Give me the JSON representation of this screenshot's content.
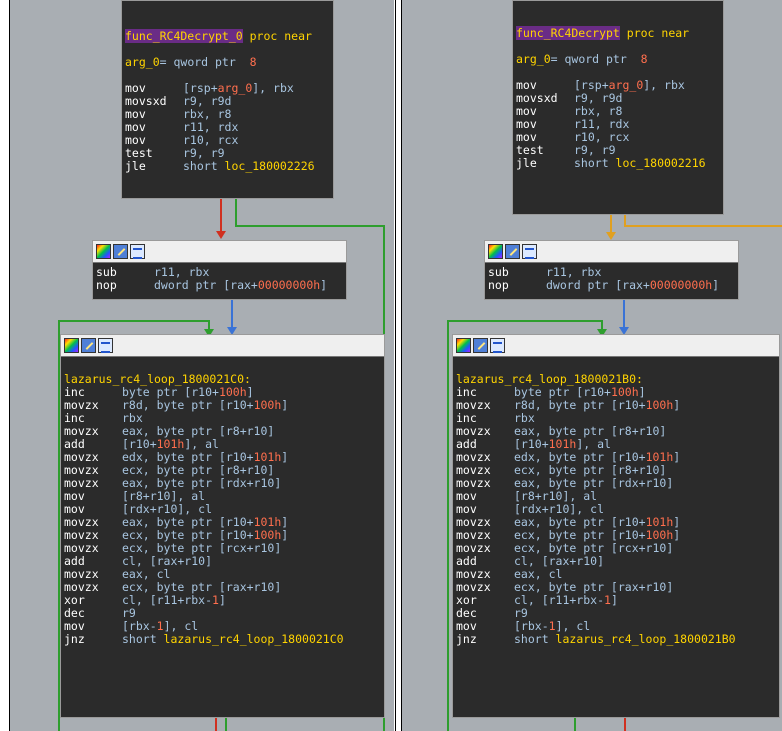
{
  "left": {
    "proc": {
      "func_name": "func_RC4Decrypt_0",
      "proc_kw": " proc near",
      "arg_name": "arg_0",
      "arg_decl": "= qword ptr  ",
      "arg_off": "8",
      "lines": [
        {
          "m": "mov",
          "p": [
            [
              "op",
              "[rsp+"
            ],
            [
              "arg",
              "arg_0"
            ],
            [
              "op",
              "], rbx"
            ]
          ]
        },
        {
          "m": "movsxd",
          "p": [
            [
              "op",
              "r9, r9d"
            ]
          ]
        },
        {
          "m": "mov",
          "p": [
            [
              "op",
              "rbx, r8"
            ]
          ]
        },
        {
          "m": "mov",
          "p": [
            [
              "op",
              "r11, rdx"
            ]
          ]
        },
        {
          "m": "mov",
          "p": [
            [
              "op",
              "r10, rcx"
            ]
          ]
        },
        {
          "m": "test",
          "p": [
            [
              "op",
              "r9, r9"
            ]
          ]
        },
        {
          "m": "jle",
          "p": [
            [
              "op",
              "short "
            ],
            [
              "lbl",
              "loc_180002226"
            ]
          ]
        }
      ]
    },
    "mid": {
      "lines": [
        {
          "m": "sub",
          "p": [
            [
              "op",
              "r11, rbx"
            ]
          ]
        },
        {
          "m": "nop",
          "p": [
            [
              "op",
              "dword ptr [rax+"
            ],
            [
              "num",
              "00000000h"
            ],
            [
              "op",
              "]"
            ]
          ]
        }
      ]
    },
    "loop": {
      "label": "lazarus_rc4_loop_1800021C0:",
      "lines": [
        {
          "m": "inc",
          "p": [
            [
              "op",
              "byte ptr [r10+"
            ],
            [
              "num",
              "100h"
            ],
            [
              "op",
              "]"
            ]
          ]
        },
        {
          "m": "movzx",
          "p": [
            [
              "op",
              "r8d, byte ptr [r10+"
            ],
            [
              "num",
              "100h"
            ],
            [
              "op",
              "]"
            ]
          ]
        },
        {
          "m": "inc",
          "p": [
            [
              "op",
              "rbx"
            ]
          ]
        },
        {
          "m": "movzx",
          "p": [
            [
              "op",
              "eax, byte ptr [r8+r10]"
            ]
          ]
        },
        {
          "m": "add",
          "p": [
            [
              "op",
              "[r10+"
            ],
            [
              "num",
              "101h"
            ],
            [
              "op",
              "], al"
            ]
          ]
        },
        {
          "m": "movzx",
          "p": [
            [
              "op",
              "edx, byte ptr [r10+"
            ],
            [
              "num",
              "101h"
            ],
            [
              "op",
              "]"
            ]
          ]
        },
        {
          "m": "movzx",
          "p": [
            [
              "op",
              "ecx, byte ptr [r8+r10]"
            ]
          ]
        },
        {
          "m": "movzx",
          "p": [
            [
              "op",
              "eax, byte ptr [rdx+r10]"
            ]
          ]
        },
        {
          "m": "mov",
          "p": [
            [
              "op",
              "[r8+r10], al"
            ]
          ]
        },
        {
          "m": "mov",
          "p": [
            [
              "op",
              "[rdx+r10], cl"
            ]
          ]
        },
        {
          "m": "movzx",
          "p": [
            [
              "op",
              "eax, byte ptr [r10+"
            ],
            [
              "num",
              "101h"
            ],
            [
              "op",
              "]"
            ]
          ]
        },
        {
          "m": "movzx",
          "p": [
            [
              "op",
              "ecx, byte ptr [r10+"
            ],
            [
              "num",
              "100h"
            ],
            [
              "op",
              "]"
            ]
          ]
        },
        {
          "m": "movzx",
          "p": [
            [
              "op",
              "ecx, byte ptr [rcx+r10]"
            ]
          ]
        },
        {
          "m": "add",
          "p": [
            [
              "op",
              "cl, [rax+r10]"
            ]
          ]
        },
        {
          "m": "movzx",
          "p": [
            [
              "op",
              "eax, cl"
            ]
          ]
        },
        {
          "m": "movzx",
          "p": [
            [
              "op",
              "ecx, byte ptr [rax+r10]"
            ]
          ]
        },
        {
          "m": "xor",
          "p": [
            [
              "op",
              "cl, [r11+rbx-"
            ],
            [
              "num",
              "1"
            ],
            [
              "op",
              "]"
            ]
          ]
        },
        {
          "m": "dec",
          "p": [
            [
              "op",
              "r9"
            ]
          ]
        },
        {
          "m": "mov",
          "p": [
            [
              "op",
              "[rbx-"
            ],
            [
              "num",
              "1"
            ],
            [
              "op",
              "], cl"
            ]
          ]
        },
        {
          "m": "jnz",
          "p": [
            [
              "op",
              "short "
            ],
            [
              "lbl",
              "lazarus_rc4_loop_1800021C0"
            ]
          ]
        }
      ]
    }
  },
  "right": {
    "proc": {
      "func_name": "func_RC4Decrypt",
      "proc_kw": " proc near",
      "arg_name": "arg_0",
      "arg_decl": "= qword ptr  ",
      "arg_off": "8",
      "lines": [
        {
          "m": "mov",
          "p": [
            [
              "op",
              "[rsp+"
            ],
            [
              "arg",
              "arg_0"
            ],
            [
              "op",
              "], rbx"
            ]
          ]
        },
        {
          "m": "movsxd",
          "p": [
            [
              "op",
              "r9, r9d"
            ]
          ]
        },
        {
          "m": "mov",
          "p": [
            [
              "op",
              "rbx, r8"
            ]
          ]
        },
        {
          "m": "mov",
          "p": [
            [
              "op",
              "r11, rdx"
            ]
          ]
        },
        {
          "m": "mov",
          "p": [
            [
              "op",
              "r10, rcx"
            ]
          ]
        },
        {
          "m": "test",
          "p": [
            [
              "op",
              "r9, r9"
            ]
          ]
        },
        {
          "m": "jle",
          "p": [
            [
              "op",
              "short "
            ],
            [
              "lbl",
              "loc_180002216"
            ]
          ]
        }
      ]
    },
    "mid": {
      "lines": [
        {
          "m": "sub",
          "p": [
            [
              "op",
              "r11, rbx"
            ]
          ]
        },
        {
          "m": "nop",
          "p": [
            [
              "op",
              "dword ptr [rax+"
            ],
            [
              "num",
              "00000000h"
            ],
            [
              "op",
              "]"
            ]
          ]
        }
      ]
    },
    "loop": {
      "label": "lazarus_rc4_loop_1800021B0:",
      "lines": [
        {
          "m": "inc",
          "p": [
            [
              "op",
              "byte ptr [r10+"
            ],
            [
              "num",
              "100h"
            ],
            [
              "op",
              "]"
            ]
          ]
        },
        {
          "m": "movzx",
          "p": [
            [
              "op",
              "r8d, byte ptr [r10+"
            ],
            [
              "num",
              "100h"
            ],
            [
              "op",
              "]"
            ]
          ]
        },
        {
          "m": "inc",
          "p": [
            [
              "op",
              "rbx"
            ]
          ]
        },
        {
          "m": "movzx",
          "p": [
            [
              "op",
              "eax, byte ptr [r8+r10]"
            ]
          ]
        },
        {
          "m": "add",
          "p": [
            [
              "op",
              "[r10+"
            ],
            [
              "num",
              "101h"
            ],
            [
              "op",
              "], al"
            ]
          ]
        },
        {
          "m": "movzx",
          "p": [
            [
              "op",
              "edx, byte ptr [r10+"
            ],
            [
              "num",
              "101h"
            ],
            [
              "op",
              "]"
            ]
          ]
        },
        {
          "m": "movzx",
          "p": [
            [
              "op",
              "ecx, byte ptr [r8+r10]"
            ]
          ]
        },
        {
          "m": "movzx",
          "p": [
            [
              "op",
              "eax, byte ptr [rdx+r10]"
            ]
          ]
        },
        {
          "m": "mov",
          "p": [
            [
              "op",
              "[r8+r10], al"
            ]
          ]
        },
        {
          "m": "mov",
          "p": [
            [
              "op",
              "[rdx+r10], cl"
            ]
          ]
        },
        {
          "m": "movzx",
          "p": [
            [
              "op",
              "eax, byte ptr [r10+"
            ],
            [
              "num",
              "101h"
            ],
            [
              "op",
              "]"
            ]
          ]
        },
        {
          "m": "movzx",
          "p": [
            [
              "op",
              "ecx, byte ptr [r10+"
            ],
            [
              "num",
              "100h"
            ],
            [
              "op",
              "]"
            ]
          ]
        },
        {
          "m": "movzx",
          "p": [
            [
              "op",
              "ecx, byte ptr [rcx+r10]"
            ]
          ]
        },
        {
          "m": "add",
          "p": [
            [
              "op",
              "cl, [rax+r10]"
            ]
          ]
        },
        {
          "m": "movzx",
          "p": [
            [
              "op",
              "eax, cl"
            ]
          ]
        },
        {
          "m": "movzx",
          "p": [
            [
              "op",
              "ecx, byte ptr [rax+r10]"
            ]
          ]
        },
        {
          "m": "xor",
          "p": [
            [
              "op",
              "cl, [r11+rbx-"
            ],
            [
              "num",
              "1"
            ],
            [
              "op",
              "]"
            ]
          ]
        },
        {
          "m": "dec",
          "p": [
            [
              "op",
              "r9"
            ]
          ]
        },
        {
          "m": "mov",
          "p": [
            [
              "op",
              "[rbx-"
            ],
            [
              "num",
              "1"
            ],
            [
              "op",
              "], cl"
            ]
          ]
        },
        {
          "m": "jnz",
          "p": [
            [
              "op",
              "short "
            ],
            [
              "lbl",
              "lazarus_rc4_loop_1800021B0"
            ]
          ]
        }
      ]
    }
  },
  "icons": [
    "graph-icon",
    "edit-icon",
    "xref-icon"
  ],
  "colors": {
    "canvas": "#a9aeb3",
    "node_bg": "#2b2b2b",
    "mnemonic": "#ffffff",
    "operand": "#a8c5e0",
    "label": "#ffd400",
    "number": "#ff6f4e",
    "func_highlight": "#6a2c86",
    "edge_true": "#2e9e2e",
    "edge_false_left": "#d03020",
    "edge_false_right": "#e0a020",
    "edge_flow": "#3a73d6"
  }
}
